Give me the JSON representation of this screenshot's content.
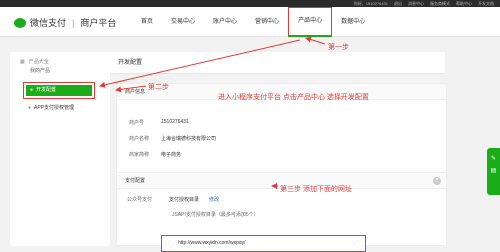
{
  "topbar": {
    "links": [
      "你好，1510276431",
      "退出",
      "消息中心",
      "服务商模式",
      "帮助中心",
      "开发文档"
    ]
  },
  "header": {
    "brand": "微信支付",
    "platform": "商户平台",
    "nav": [
      "首页",
      "交易中心",
      "账户中心",
      "营销中心",
      "产品中心",
      "数据中心"
    ],
    "active_nav_index": 4
  },
  "annotations": {
    "step1": "第一步",
    "step2": "第二步",
    "step2_desc": "进入小程序支付平台  点击产品中心  选择开发配置",
    "step3": "第三步  添加下面的网址"
  },
  "sidebar": {
    "group": "产品大全",
    "sub": "我的产品",
    "active": "开发配置",
    "item2": "APP支付授权管理"
  },
  "main": {
    "panel_title": "开发配置",
    "merchant_card": {
      "title": "商户信息",
      "rows": [
        {
          "k": "商户号",
          "v": "1510276431"
        },
        {
          "k": "商户名称",
          "v": "上海合瑞德科技有限公司"
        },
        {
          "k": "商家简称",
          "v": "电子商务"
        }
      ]
    },
    "pay_card": {
      "title": "支付配置",
      "label": "公众号支付",
      "auth_dir": "支付授权目录",
      "modify": "修改",
      "jsapi": "JSAPI支付授权目录（最多可添加5个）",
      "url": "http://www.wxyidn.com/wxpay/"
    }
  },
  "colors": {
    "brand": "#1aad19",
    "annotation": "#e53935"
  }
}
